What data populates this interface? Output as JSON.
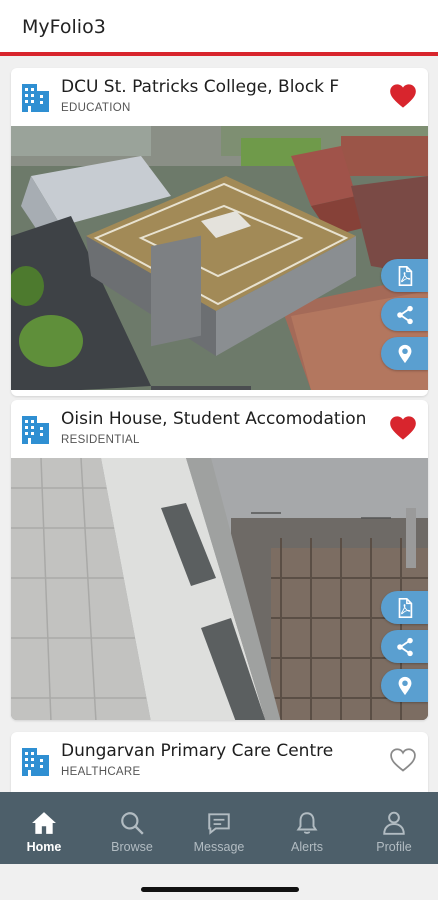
{
  "app": {
    "title": "MyFolio3"
  },
  "colors": {
    "accent": "#d8252d",
    "icon_blue": "#2f8fd2",
    "action_blue": "#5a9fd0",
    "tabbar": "#4d5f6a"
  },
  "projects": [
    {
      "title": "DCU St. Patricks College, Block F",
      "category": "EDUCATION",
      "favorite": true,
      "actions": [
        "pdf-icon",
        "share-icon",
        "location-pin-icon"
      ]
    },
    {
      "title": "Oisin House, Student Accomodation",
      "category": "RESIDENTIAL",
      "favorite": true,
      "actions": [
        "pdf-icon",
        "share-icon",
        "location-pin-icon"
      ]
    },
    {
      "title": "Dungarvan Primary Care Centre",
      "category": "HEALTHCARE",
      "favorite": false
    }
  ],
  "tabbar": {
    "tabs": [
      {
        "label": "Home",
        "icon": "home-icon",
        "active": true
      },
      {
        "label": "Browse",
        "icon": "search-icon",
        "active": false
      },
      {
        "label": "Message",
        "icon": "message-icon",
        "active": false
      },
      {
        "label": "Alerts",
        "icon": "bell-icon",
        "active": false
      },
      {
        "label": "Profile",
        "icon": "profile-icon",
        "active": false
      }
    ]
  }
}
